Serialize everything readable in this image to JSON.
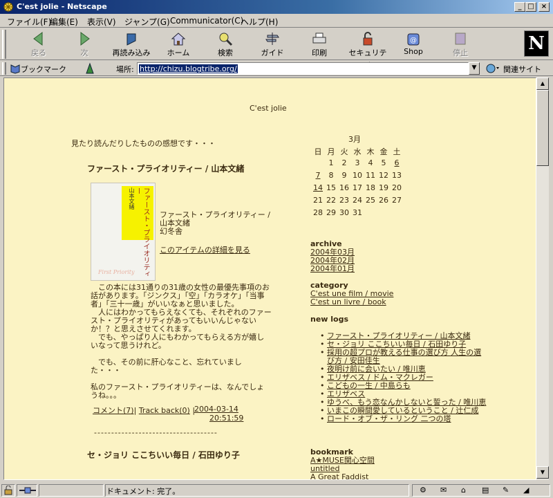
{
  "window": {
    "title": "C'est jolie - Netscape",
    "min": "_",
    "max": "□",
    "close": "×"
  },
  "menu": [
    "ファイル(F)",
    "編集(E)",
    "表示(V)",
    "ジャンプ(G)",
    "Communicator(C)",
    "ヘルプ(H)"
  ],
  "toolbar": {
    "back": "戻る",
    "forward": "次",
    "reload": "再読み込み",
    "home": "ホーム",
    "search": "検索",
    "guide": "ガイド",
    "print": "印刷",
    "security": "セキュリティ",
    "shop": "Shop",
    "stop": "停止",
    "logo": "N"
  },
  "location": {
    "bookmarks": "ブックマーク",
    "label": "場所:",
    "url": "http://chizu.blogtribe.org/",
    "related": "関連サイト"
  },
  "page": {
    "site_title": "C'est jolie",
    "description": "見たり読んだりしたものの感想です・・・",
    "post": {
      "title": "ファースト・プライオリティー / 山本文緒",
      "book_cover_title": "ファースト・プライオリティー",
      "book_cover_author": "山本文緒",
      "book_cover_en": "First Priority",
      "book_line1": "ファースト・プライオリティー /",
      "book_line2": "山本文緒",
      "book_line3": "幻冬舎",
      "detail_link": "このアイテムの詳細を見る",
      "p1": "　この本には31通りの31歳の女性の最優先事項のお話があります。「ジンクス」「空」「カラオケ」「当事者」「三十一歳」がいいなぁと思いました。\n　人にはわかってもらえなくても、それぞれのファースト・プライオリティがあってもいいんじゃないか！？と思えさせてくれます。\n　でも、やっぱり人にもわかってもらえる方が嬉しいなって思うけれど。",
      "p2": "　でも、その前に肝心なこと、忘れていました・・・",
      "p3": "私のファースト・プライオリティーは、なんでしょうね。。。",
      "comment_link": "コメント(7)",
      "sep1": "|",
      "trackback_link": "Track back(0)",
      "sep2": "|",
      "date": "2004-03-14",
      "time": "20:51:59",
      "divider": "------------------------------------"
    },
    "post2_title": "セ・ジョリ ここちいい毎日 / 石田ゆり子"
  },
  "calendar": {
    "month": "3月",
    "weekdays": [
      "日",
      "月",
      "火",
      "水",
      "木",
      "金",
      "土"
    ],
    "weeks": [
      [
        "",
        "1",
        "2",
        "3",
        "4",
        "5",
        "6"
      ],
      [
        "7",
        "8",
        "9",
        "10",
        "11",
        "12",
        "13"
      ],
      [
        "14",
        "15",
        "16",
        "17",
        "18",
        "19",
        "20"
      ],
      [
        "21",
        "22",
        "23",
        "24",
        "25",
        "26",
        "27"
      ],
      [
        "28",
        "29",
        "30",
        "31",
        "",
        "",
        ""
      ]
    ],
    "linked_days": [
      "6",
      "7",
      "14"
    ]
  },
  "sidebar": {
    "archive_heading": "archive",
    "archive": [
      "2004年03月",
      "2004年02月",
      "2004年01月"
    ],
    "category_heading": "category",
    "categories": [
      "C'est une film / movie",
      "C'est un livre / book"
    ],
    "newlogs_heading": "new logs",
    "newlogs": [
      "ファースト・プライオリティー / 山本文緒",
      "セ・ジョリ ここちいい毎日 / 石田ゆり子",
      "採用の超プロが教える仕事の選び方 人生の選び方 / 安田佳生",
      "夜明け前に会いたい / 唯川恵",
      "エリザベス / ドム・マクレガー",
      "こどもの一生 / 中島らも",
      "エリザベス",
      "ゆうべ、もう恋なんかしないと誓った / 唯川恵",
      "いまこの瞬間愛しているということ / 辻仁成",
      "ロード・オブ・ザ・リング 二つの塔"
    ],
    "bookmark_heading": "bookmark",
    "bookmarks": [
      "A★MUSE関心空間",
      "untitled",
      "A Great Faddist"
    ]
  },
  "status": {
    "message": "ドキュメント: 完了。"
  }
}
